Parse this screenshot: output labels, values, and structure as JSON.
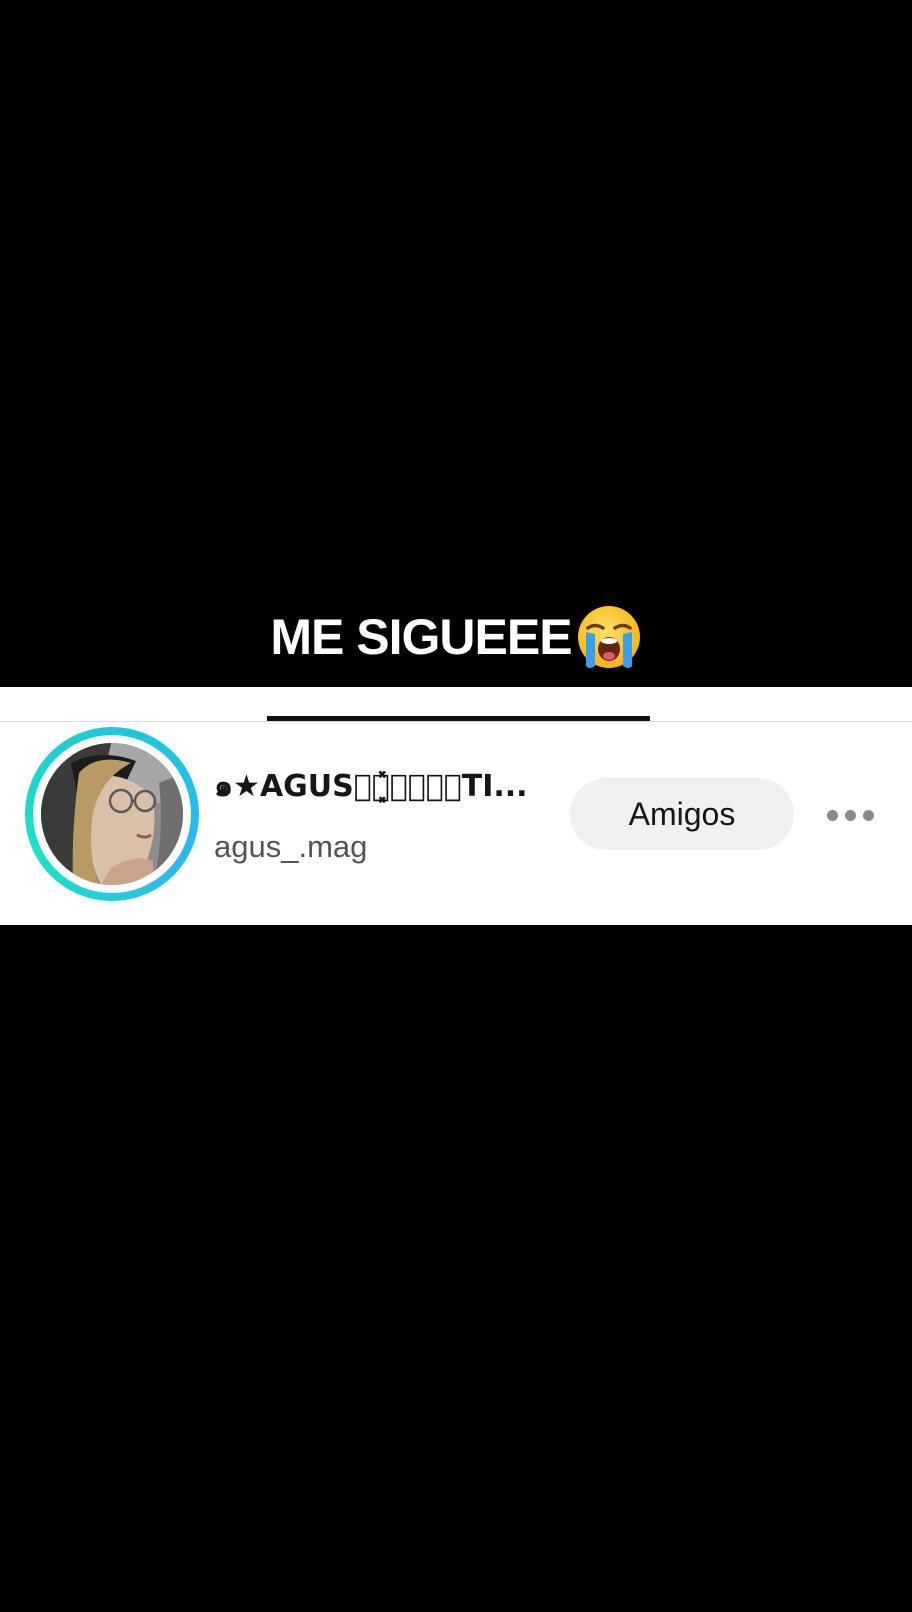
{
  "caption": {
    "text": "ME SIGUEEE",
    "emoji": "loudly-crying-face"
  },
  "profile_card": {
    "display_name": "๑★AGUS༚ེ͓̽༚ཱྀ⃟TI...",
    "username": "agus_.mag",
    "friends_button_label": "Amigos",
    "more_icon": "more-horizontal-icon",
    "ring_color": "#1ec8d8"
  }
}
